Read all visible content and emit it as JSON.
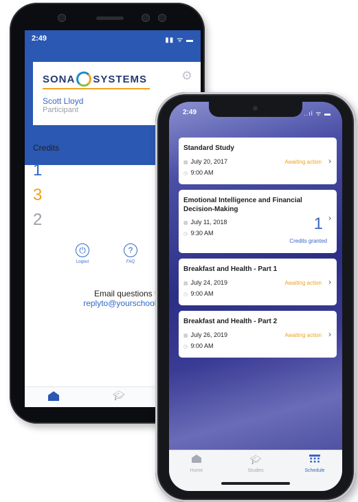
{
  "android": {
    "status_time": "2:49",
    "status_icons": "▮▮ ᯤ ▬",
    "logo": {
      "left": "SONA",
      "right": "SYSTEMS",
      "icon": "sona-ring-logo"
    },
    "settings_icon": "gear-icon",
    "user_name": "Scott Lloyd",
    "user_role": "Participant",
    "credits_label": "Credits",
    "credits": [
      "1",
      "3",
      "2"
    ],
    "credit_colors": [
      "#2f67c8",
      "#f0a11c",
      "#9a9ea6"
    ],
    "actions": [
      {
        "label": "Logout",
        "icon": "power-icon"
      },
      {
        "label": "FAQ",
        "icon": "question-icon"
      }
    ],
    "email_question": "Email questions to",
    "email_address": "replyto@yourschool.edu",
    "tabs": [
      {
        "icon": "home-icon"
      },
      {
        "icon": "graduation-cap-icon"
      }
    ]
  },
  "iphone": {
    "status_time": "2:49",
    "status_icons": "..ıl ᯤ ▬",
    "studies": [
      {
        "title": "Standard Study",
        "date": "July 20, 2017",
        "time": "9:00 AM",
        "status": "Awaiting action"
      },
      {
        "title": "Emotional Intelligence and Financial Decision-Making",
        "date": "July 11, 2018",
        "time": "9:30 AM",
        "credits": "1",
        "status": "Credits granted"
      },
      {
        "title": "Breakfast and Health - Part 1",
        "date": "July 24, 2019",
        "time": "9:00 AM",
        "status": "Awaiting action"
      },
      {
        "title": "Breakfast and Health - Part 2",
        "date": "July 26, 2019",
        "time": "9:00 AM",
        "status": "Awaiting action"
      }
    ],
    "tabs": [
      {
        "label": "Home",
        "icon": "home-icon"
      },
      {
        "label": "Studies",
        "icon": "graduation-cap-icon"
      },
      {
        "label": "Schedule",
        "icon": "calendar-grid-icon",
        "active": true
      }
    ]
  },
  "colors": {
    "brand_blue": "#2a58b3",
    "accent_orange": "#f0a11c",
    "link_blue": "#3a66c4"
  }
}
